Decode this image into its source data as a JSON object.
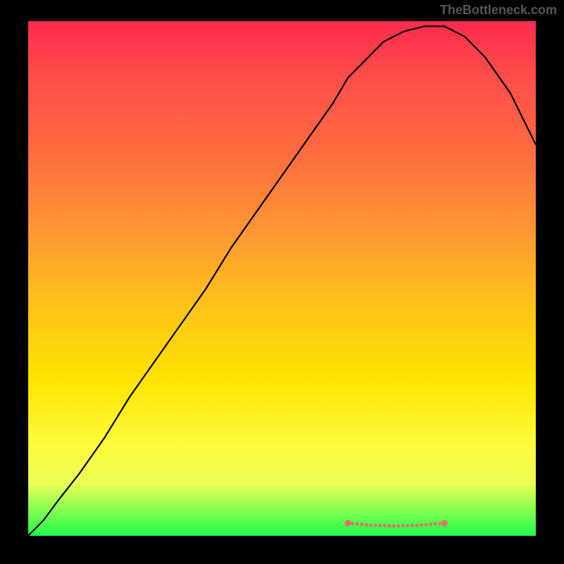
{
  "attribution": "TheBottleneck.com",
  "chart_data": {
    "type": "line",
    "title": "",
    "xlabel": "",
    "ylabel": "",
    "xlim": [
      0,
      100
    ],
    "ylim": [
      0,
      100
    ],
    "series": [
      {
        "name": "curve",
        "x": [
          0,
          3,
          6,
          10,
          15,
          20,
          25,
          30,
          35,
          40,
          45,
          50,
          55,
          60,
          63,
          67,
          70,
          74,
          78,
          82,
          86,
          90,
          95,
          100
        ],
        "values": [
          0,
          3,
          7,
          12,
          19,
          27,
          34,
          41,
          48,
          56,
          63,
          70,
          77,
          84,
          89,
          93,
          96,
          98,
          99,
          99,
          97,
          93,
          86,
          76
        ]
      }
    ],
    "flat_region": {
      "x_start": 63,
      "x_end": 82,
      "color": "#e86a6d"
    },
    "gradient_stops": [
      {
        "pos": 0,
        "color": "#ff2a4d"
      },
      {
        "pos": 0.25,
        "color": "#ff6a3f"
      },
      {
        "pos": 0.55,
        "color": "#ffc219"
      },
      {
        "pos": 0.82,
        "color": "#fffb3a"
      },
      {
        "pos": 1.0,
        "color": "#1fff4a"
      }
    ]
  }
}
